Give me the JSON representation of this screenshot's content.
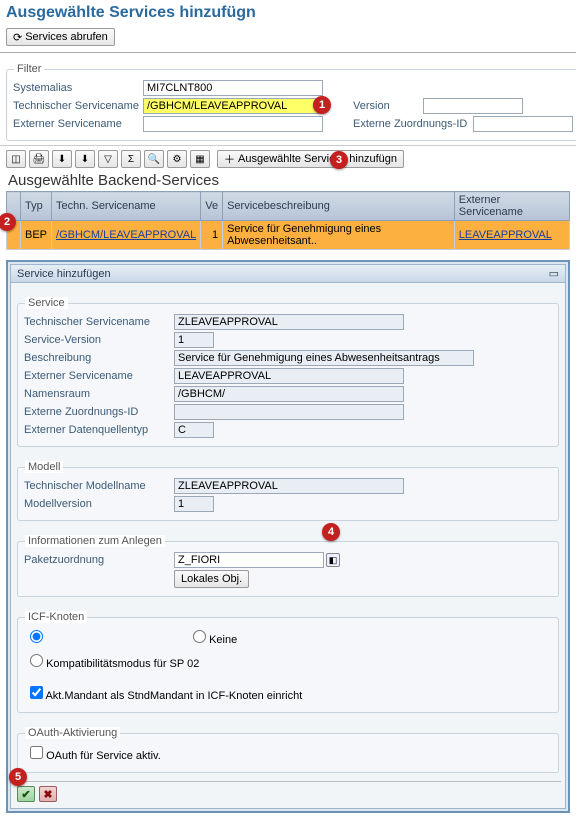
{
  "title": "Ausgewählte Services hinzufügn",
  "toolbar": {
    "refresh": "Services abrufen"
  },
  "filter": {
    "legend": "Filter",
    "systemalias_label": "Systemalias",
    "systemalias_value": "MI7CLNT800",
    "tech_name_label": "Technischer Servicename",
    "tech_name_value": "/GBHCM/LEAVEAPPROVAL",
    "version_label": "Version",
    "version_value": "",
    "ext_name_label": "Externer Servicename",
    "ext_name_value": "",
    "ext_map_label": "Externe Zuordnungs-ID",
    "ext_map_value": ""
  },
  "icons": [
    "chart",
    "print",
    "exportxl",
    "exportword",
    "filter",
    "sum",
    "find",
    "settings",
    "layout"
  ],
  "add_selected_btn": "Ausgewählte Services hinzufügn",
  "section_title": "Ausgewählte Backend-Services",
  "table": {
    "headers": [
      "Typ",
      "Techn. Servicename",
      "Ve",
      "Servicebeschreibung",
      "Externer Servicename"
    ],
    "rows": [
      {
        "typ": "BEP",
        "tech": "/GBHCM/LEAVEAPPROVAL",
        "ver": "1",
        "desc": "Service für Genehmigung eines Abwesenheitsant..",
        "ext": "LEAVEAPPROVAL"
      }
    ]
  },
  "dialog": {
    "title": "Service hinzufügen",
    "service": {
      "legend": "Service",
      "tech_label": "Technischer Servicename",
      "tech": "ZLEAVEAPPROVAL",
      "ver_label": "Service-Version",
      "ver": "1",
      "desc_label": "Beschreibung",
      "desc": "Service für Genehmigung eines Abwesenheitsantrags",
      "ext_label": "Externer Servicename",
      "ext": "LEAVEAPPROVAL",
      "ns_label": "Namensraum",
      "ns": "/GBHCM/",
      "map_label": "Externe Zuordnungs-ID",
      "map": "",
      "dq_label": "Externer Datenquellentyp",
      "dq": "C"
    },
    "model": {
      "legend": "Modell",
      "tech_label": "Technischer Modellname",
      "tech": "ZLEAVEAPPROVAL",
      "ver_label": "Modellversion",
      "ver": "1"
    },
    "create": {
      "legend": "Informationen zum Anlegen",
      "pkg_label": "Paketzuordnung",
      "pkg": "Z_FIORI",
      "localbtn": "Lokales Obj."
    },
    "icf": {
      "legend": "ICF-Knoten",
      "opt_none": "Keine",
      "opt_compat": "Kompatibilitätsmodus für SP 02",
      "chk": "Akt.Mandant als StndMandant in ICF-Knoten einricht"
    },
    "oauth": {
      "legend": "OAuth-Aktivierung",
      "chk": "OAuth für Service aktiv."
    }
  },
  "badges": {
    "b1": "1",
    "b2": "2",
    "b3": "3",
    "b4": "4",
    "b5": "5"
  }
}
